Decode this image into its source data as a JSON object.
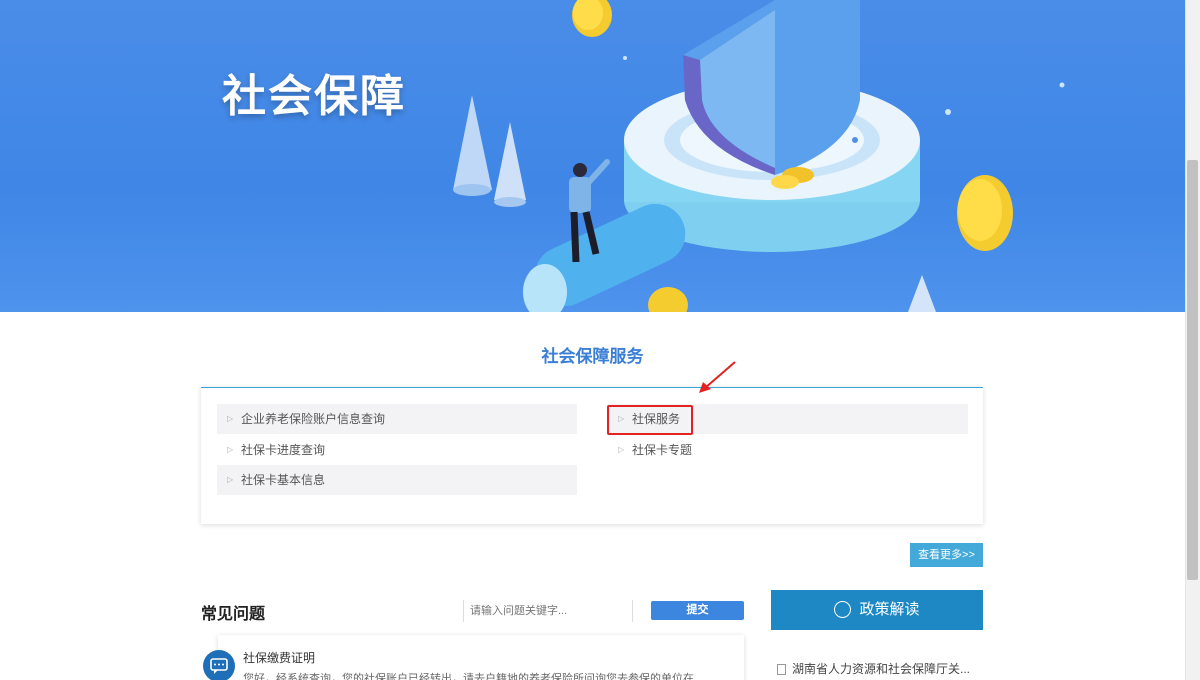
{
  "hero": {
    "title": "社会保障"
  },
  "services": {
    "section_title": "社会保障服务",
    "left_items": [
      "企业养老保险账户信息查询",
      "社保卡进度查询",
      "社保卡基本信息"
    ],
    "right_items": [
      "社保服务",
      "社保卡专题"
    ],
    "highlighted_item": "社保服务",
    "more_label": "查看更多>>"
  },
  "faq": {
    "title": "常见问题",
    "search_placeholder": "请输入问题关键字...",
    "submit_label": "提交",
    "question": "社保缴费证明",
    "answer": "您好，经系统查询，您的社保账户已经转出，请去户籍地的养老保险所问询您去参保的单位在..."
  },
  "policy": {
    "button_label": "政策解读",
    "item": "湖南省人力资源和社会保障厅关..."
  },
  "colors": {
    "hero_bg": "#4a8de8",
    "accent": "#3a7fd6",
    "highlight": "#e32222",
    "policy_bg": "#1e88c5"
  }
}
